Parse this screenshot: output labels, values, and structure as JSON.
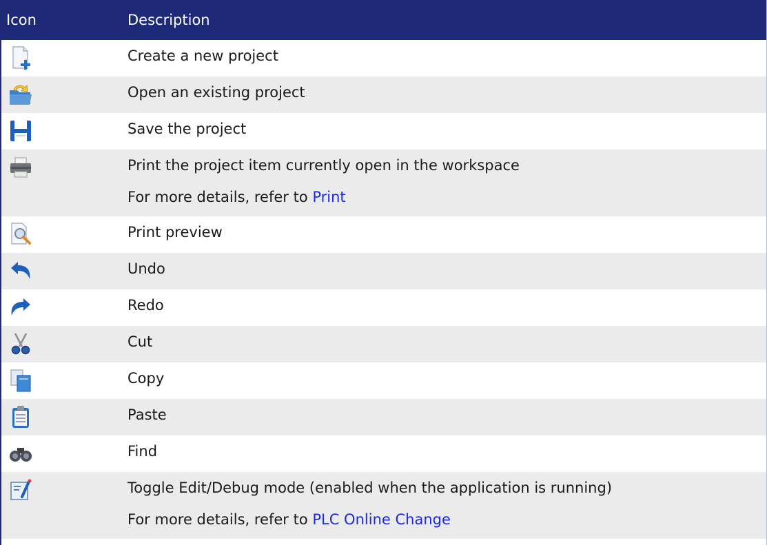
{
  "header": {
    "icon_col": "Icon",
    "desc_col": "Description"
  },
  "rows": [
    {
      "icon": "new-project-icon",
      "text": "Create a new project"
    },
    {
      "icon": "open-folder-icon",
      "text": "Open an existing project"
    },
    {
      "icon": "save-disk-icon",
      "text": "Save the project"
    },
    {
      "icon": "printer-icon",
      "text": "Print the project item currently open in the workspace",
      "more_prefix": "For more details, refer to ",
      "more_link": "Print"
    },
    {
      "icon": "print-preview-icon",
      "text": "Print preview"
    },
    {
      "icon": "undo-icon",
      "text": "Undo"
    },
    {
      "icon": "redo-icon",
      "text": "Redo"
    },
    {
      "icon": "scissors-icon",
      "text": "Cut"
    },
    {
      "icon": "copy-icon",
      "text": "Copy"
    },
    {
      "icon": "paste-clipboard-icon",
      "text": "Paste"
    },
    {
      "icon": "binoculars-icon",
      "text": "Find"
    },
    {
      "icon": "edit-debug-toggle-icon",
      "text": "Toggle Edit/Debug mode (enabled when the application is running)",
      "more_prefix": "For more details, refer to ",
      "more_link": "PLC Online Change"
    }
  ]
}
